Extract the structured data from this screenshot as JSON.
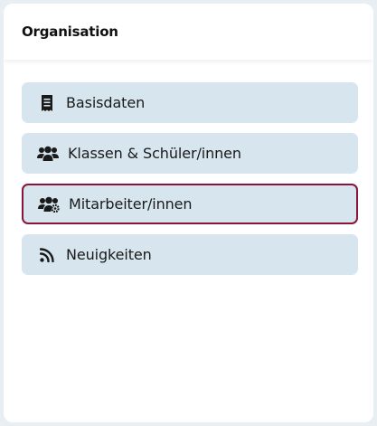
{
  "card": {
    "title": "Organisation"
  },
  "nav": {
    "items": [
      {
        "label": "Basisdaten",
        "icon": "receipt-icon",
        "active": false
      },
      {
        "label": "Klassen & Schüler/innen",
        "icon": "users-icon",
        "active": false
      },
      {
        "label": "Mitarbeiter/innen",
        "icon": "users-gear-icon",
        "active": true
      },
      {
        "label": "Neuigkeiten",
        "icon": "rss-icon",
        "active": false
      }
    ]
  },
  "colors": {
    "item_background": "#d6e5ee",
    "active_border": "#8a1538",
    "page_background": "#e8eef2"
  }
}
